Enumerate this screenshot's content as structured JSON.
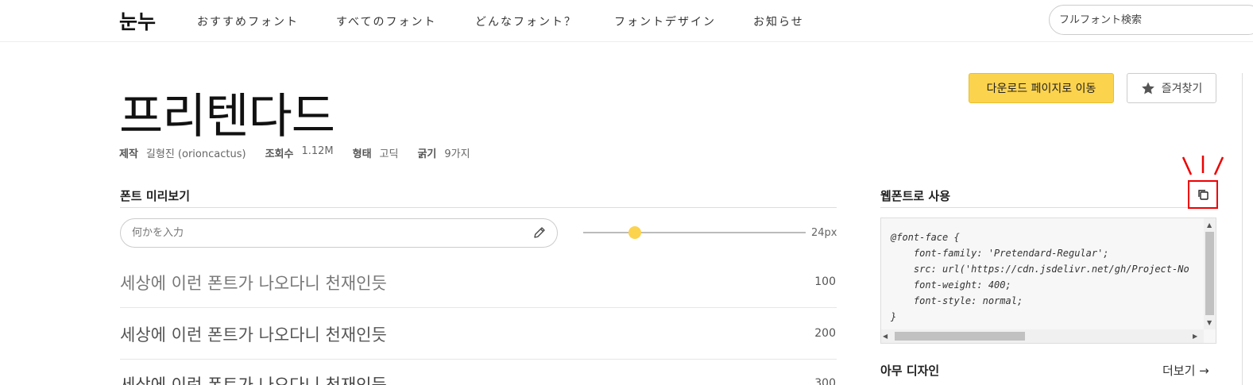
{
  "header": {
    "logo": "눈누",
    "nav": [
      "おすすめフォント",
      "すべてのフォント",
      "どんなフォント？",
      "フォントデザイン",
      "お知らせ"
    ],
    "search_placeholder": "フルフォント検索"
  },
  "font": {
    "name": "프리텐다드",
    "meta": [
      {
        "label": "제작",
        "value": "길형진 (orioncactus)"
      },
      {
        "label": "조회수",
        "value": "1.12M"
      },
      {
        "label": "형태",
        "value": "고딕"
      },
      {
        "label": "굵기",
        "value": "9가지"
      }
    ],
    "download_label": "다운로드 페이지로 이동",
    "favorite_label": "즐겨찾기"
  },
  "preview": {
    "section_title": "폰트 미리보기",
    "input_placeholder": "何かを入力",
    "size_value": "24px",
    "size_level": 0.24,
    "samples": [
      {
        "text": "세상에 이런 폰트가 나오다니 천재인듯",
        "weight": "100"
      },
      {
        "text": "세상에 이런 폰트가 나오다니 천재인듯",
        "weight": "200"
      },
      {
        "text": "세상에 이런 폰트가 나오다니 천재인듯",
        "weight": "300"
      }
    ]
  },
  "webfont": {
    "section_title": "웹폰트로 사용",
    "code": "@font-face {\n    font-family: 'Pretendard-Regular';\n    src: url('https://cdn.jsdelivr.net/gh/Project-No\n    font-weight: 400;\n    font-style: normal;\n}"
  },
  "design": {
    "section_title": "아무 디자인",
    "more_label": "더보기 →"
  },
  "colors": {
    "accent": "#fcd34d",
    "highlight": "#ee0000"
  }
}
